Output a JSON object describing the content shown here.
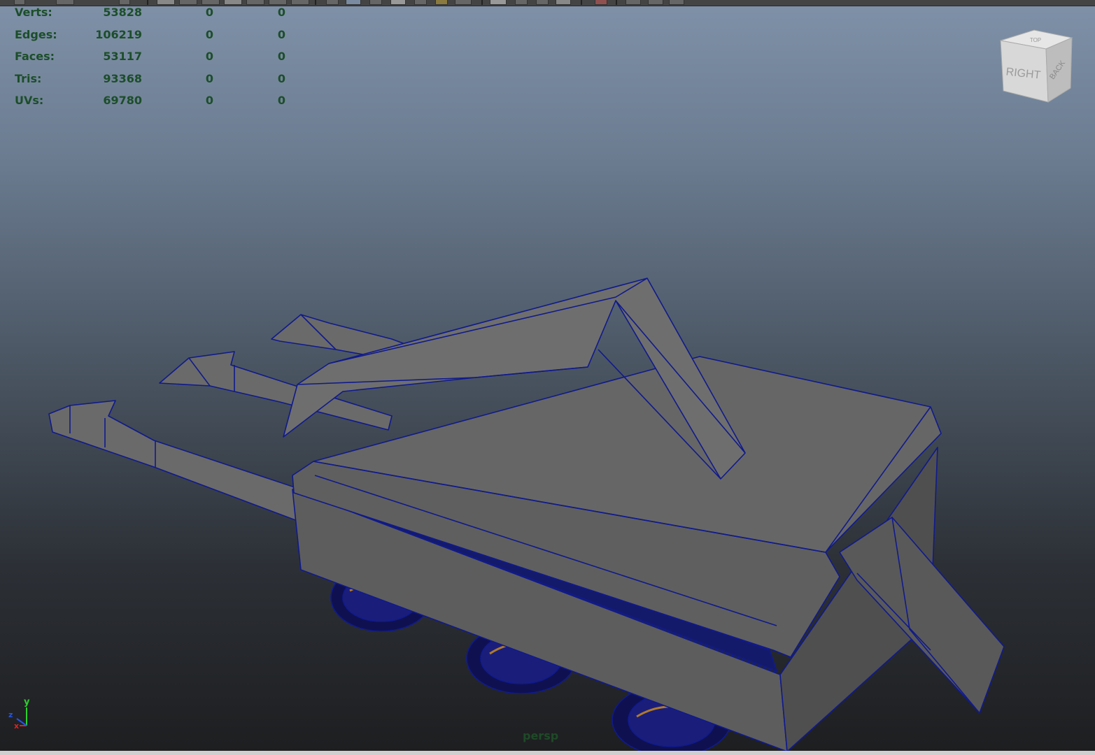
{
  "hud": {
    "rows": [
      {
        "label": "Verts:",
        "total": "53828",
        "selected": "0",
        "component": "0"
      },
      {
        "label": "Edges:",
        "total": "106219",
        "selected": "0",
        "component": "0"
      },
      {
        "label": "Faces:",
        "total": "53117",
        "selected": "0",
        "component": "0"
      },
      {
        "label": "Tris:",
        "total": "93368",
        "selected": "0",
        "component": "0"
      },
      {
        "label": "UVs:",
        "total": "69780",
        "selected": "0",
        "component": "0"
      }
    ]
  },
  "viewcube": {
    "front_face": "RIGHT",
    "side_face": "BACK",
    "top_face": "TOP"
  },
  "viewport": {
    "camera_name": "persp"
  },
  "axis_gizmo": {
    "y": "y",
    "z": "z",
    "x": "x"
  },
  "colors": {
    "wireframe": "#101a8c",
    "mesh_fill": "#6b6b6b",
    "hud_text": "#1c4e2a",
    "bg_top": "#7f91a8",
    "bg_bottom": "#1d1e20"
  }
}
